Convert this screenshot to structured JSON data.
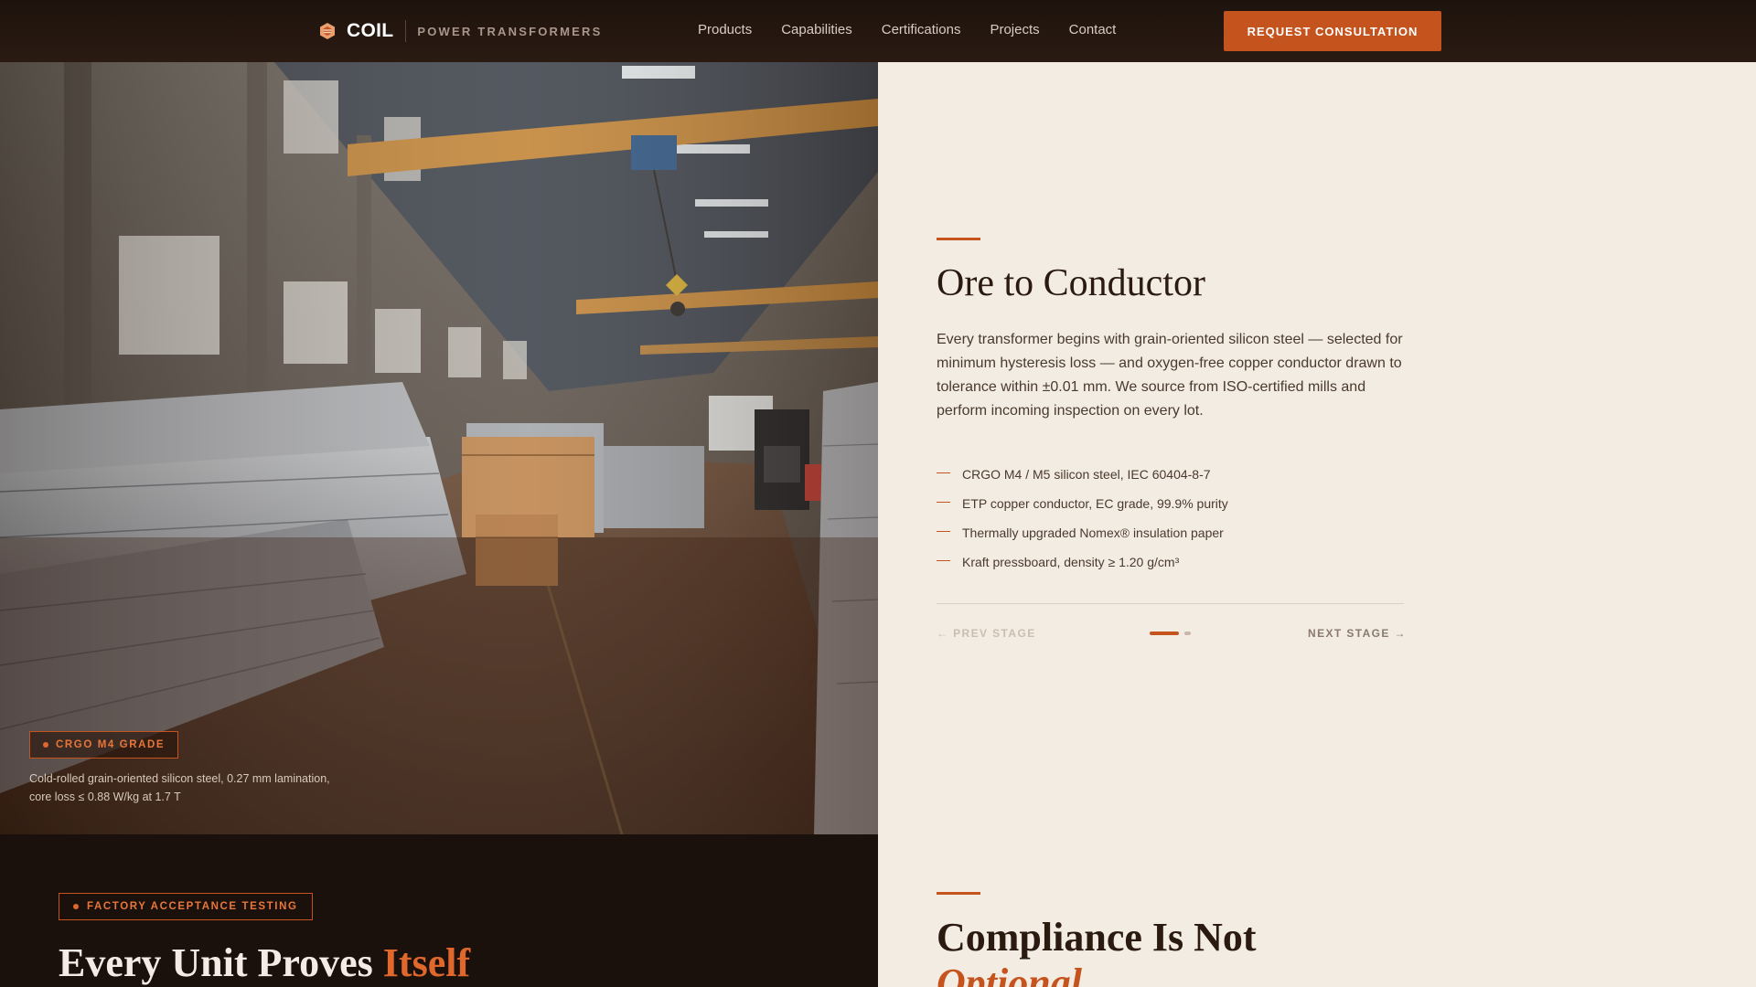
{
  "nav": {
    "brand": "COIL",
    "tagline": "POWER TRANSFORMERS",
    "links": [
      "Products",
      "Capabilities",
      "Certifications",
      "Projects",
      "Contact"
    ],
    "cta_label": "REQUEST CONSULTATION"
  },
  "hero_photo": {
    "badge": "CRGO M4 GRADE",
    "caption_line1": "Cold-rolled grain-oriented silicon steel, 0.27 mm lamination,",
    "caption_line2": "core loss ≤ 0.88 W/kg at 1.7 T"
  },
  "stage": {
    "title": "Ore to Conductor",
    "body": "Every transformer begins with grain-oriented silicon steel — selected for minimum hysteresis loss — and oxygen-free copper conductor drawn to tolerance within ±0.01 mm. We source from ISO-certified mills and perform incoming inspection on every lot.",
    "features": [
      "CRGO M4 / M5 silicon steel, IEC 60404-8-7",
      "ETP copper conductor, EC grade, 99.9% purity",
      "Thermally upgraded Nomex® insulation paper",
      "Kraft pressboard, density ≥ 1.20 g/cm³"
    ],
    "prev_label": "← PREV STAGE",
    "next_label": "NEXT STAGE →"
  },
  "testing": {
    "badge": "FACTORY ACCEPTANCE TESTING",
    "title_main": "Every Unit Proves ",
    "title_highlight": "Itself"
  },
  "compliance": {
    "title_main": "Compliance Is Not",
    "title_emphasis": "Optional"
  },
  "colors": {
    "accent": "#c5531d",
    "dark": "#1b110c",
    "cream": "#f3ece2"
  }
}
